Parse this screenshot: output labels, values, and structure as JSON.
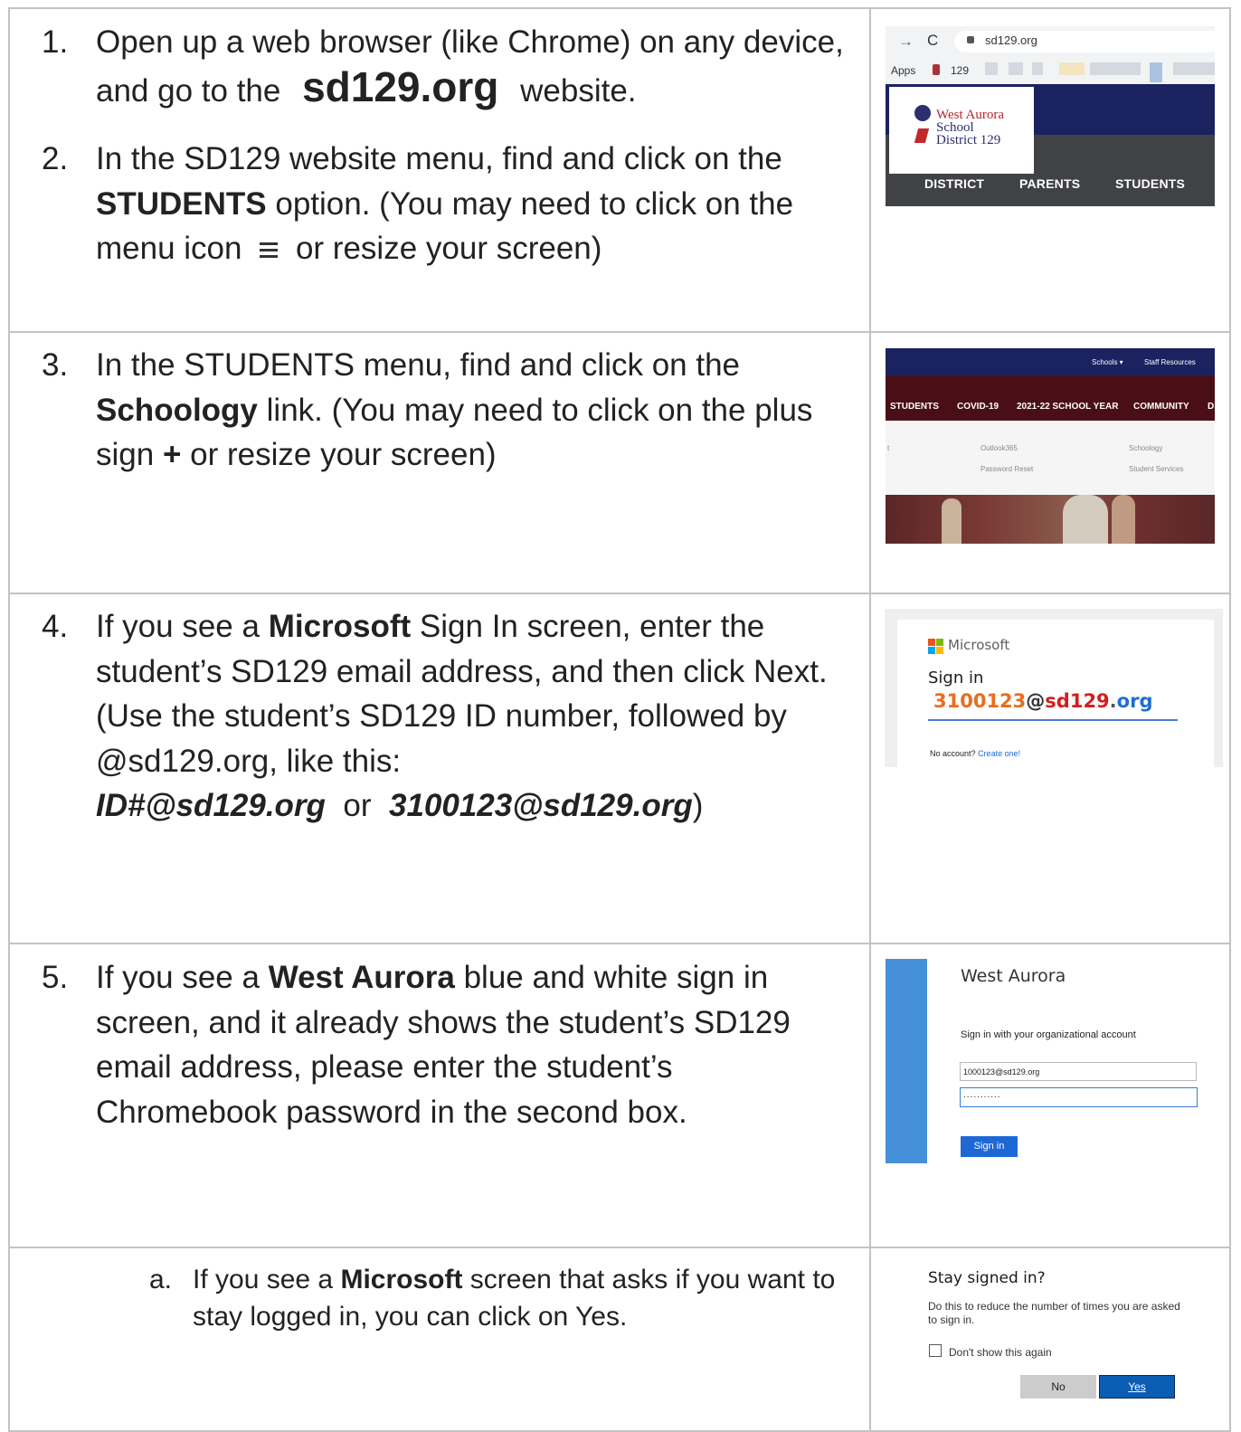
{
  "steps": {
    "s1": {
      "num": "1.",
      "t1": "Open up a web browser (like Chrome) on any device, and go to the",
      "site": "sd129.org",
      "t2": "website."
    },
    "s2": {
      "num": "2.",
      "t1": "In the SD129 website menu, find and click on the",
      "bold": "STUDENTS",
      "t2": "option.  (You may need to click on the menu icon",
      "t3": "or resize your screen)"
    },
    "s3": {
      "num": "3.",
      "t1": "In the STUDENTS menu, find and click on the",
      "bold": "Schoology",
      "t2": "link.  (You may need to click on the plus sign",
      "plus": "+",
      "t3": "or resize your screen)"
    },
    "s4": {
      "num": "4.",
      "t1": "If you see a",
      "bold": "Microsoft",
      "t2": "Sign In screen, enter the student’s SD129 email address, and then click Next.  (Use the student’s SD129 ID number, followed by @sd129.org, like this:",
      "ex1": "ID#@sd129.org",
      "or": "or",
      "ex2": "3100123@sd129.org",
      "close": ")"
    },
    "s5": {
      "num": "5.",
      "t1": "If you see a",
      "bold": "West Aurora",
      "t2": "blue and white sign in screen, and it already shows the student’s SD129 email address, please enter the student’s Chromebook password in the second box."
    },
    "s5a": {
      "num": "a.",
      "t1": "If you see a",
      "bold": "Microsoft",
      "t2": "screen that asks if you want to stay logged in, you can click on Yes."
    }
  },
  "shot_browser": {
    "url": "sd129.org",
    "apps": "Apps",
    "bookmark": "129",
    "logo_line1": "West Aurora",
    "logo_line2": "School",
    "logo_line3": "District 129",
    "nav": [
      "DISTRICT",
      "PARENTS",
      "STUDENTS"
    ],
    "colors": {
      "navy": "#1a2260",
      "dark": "#404245",
      "logo_red": "#b8242c"
    }
  },
  "shot_students": {
    "top_links": [
      "Schools ▾",
      "Staff Resources"
    ],
    "menu": [
      "STUDENTS",
      "COVID-19",
      "2021-22 SCHOOL YEAR",
      "COMMUNITY",
      "D"
    ],
    "left_fragment": "t",
    "links_col1": [
      "Outlook365",
      "Password Reset"
    ],
    "links_col2": [
      "Schoology",
      "Student Services"
    ]
  },
  "shot_ms": {
    "brand": "Microsoft",
    "heading": "Sign in",
    "email_parts": [
      "3100123",
      "@",
      "sd129",
      ".",
      "org"
    ],
    "no_account": "No account?",
    "create": "Create one!"
  },
  "shot_wa": {
    "title": "West Aurora",
    "subtitle": "Sign in with your organizational account",
    "email": "1000123@sd129.org",
    "password": "...........",
    "button": "Sign in"
  },
  "shot_stay": {
    "heading": "Stay signed in?",
    "desc": "Do this to reduce the number of times you are asked to sign in.",
    "checkbox": "Don't show this again",
    "no": "No",
    "yes": "Yes"
  }
}
